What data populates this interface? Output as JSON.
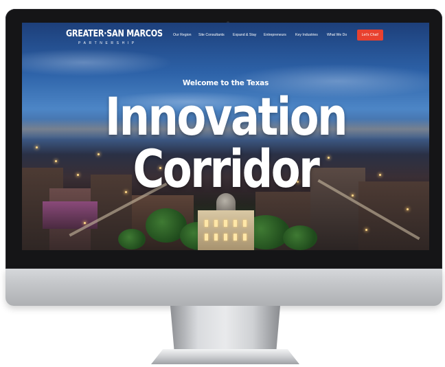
{
  "site": {
    "logo": {
      "main": "GREATER·SAN MARCOS",
      "sub": "PARTNERSHIP"
    },
    "nav": [
      {
        "label": "Our Region"
      },
      {
        "label": "Site Consultants"
      },
      {
        "label": "Expand & Stay"
      },
      {
        "label": "Entrepreneurs"
      },
      {
        "label": "Key Industries"
      },
      {
        "label": "What We Do"
      }
    ],
    "cta": "Let's Chat!",
    "hero": {
      "kicker": "Welcome to the Texas",
      "line1": "Innovation",
      "line2": "Corridor"
    }
  },
  "icons": {
    "camera": "webcam-dot-icon"
  },
  "colors": {
    "cta": "#e8412f",
    "sky": "#2d62a8",
    "bezel": "#151517"
  }
}
